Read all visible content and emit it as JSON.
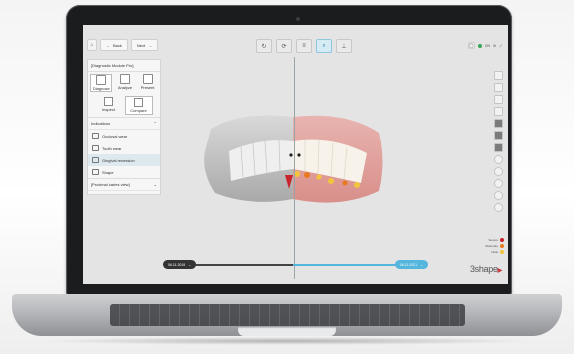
{
  "nav": {
    "back_label": "Back",
    "next_label": "Next"
  },
  "panel": {
    "title": "[Diagnostic Module Pro]",
    "tabs": [
      {
        "label": "Diagnose"
      },
      {
        "label": "Analyze"
      },
      {
        "label": "Present"
      }
    ],
    "subtabs": [
      {
        "label": "Inspect"
      },
      {
        "label": "Compare"
      }
    ],
    "section_title": "Indications",
    "items": [
      {
        "label": "Occlusal wear"
      },
      {
        "label": "Tooth wear"
      },
      {
        "label": "Gingival recession"
      },
      {
        "label": "Shape"
      }
    ],
    "footer_dropdown": "[Proximal caries view]"
  },
  "status": {
    "online_label": "ON"
  },
  "timeline": {
    "left_date": "06.11.2019",
    "right_date": "06.11.2021"
  },
  "legend": {
    "items": [
      {
        "label": "Severe",
        "color": "#c9232b"
      },
      {
        "label": "Moderate",
        "color": "#e87a1d"
      },
      {
        "label": "Initial",
        "color": "#f2c53d"
      }
    ]
  },
  "brand": {
    "logo_text": "3shape"
  },
  "colors": {
    "accent": "#54b5dd"
  }
}
